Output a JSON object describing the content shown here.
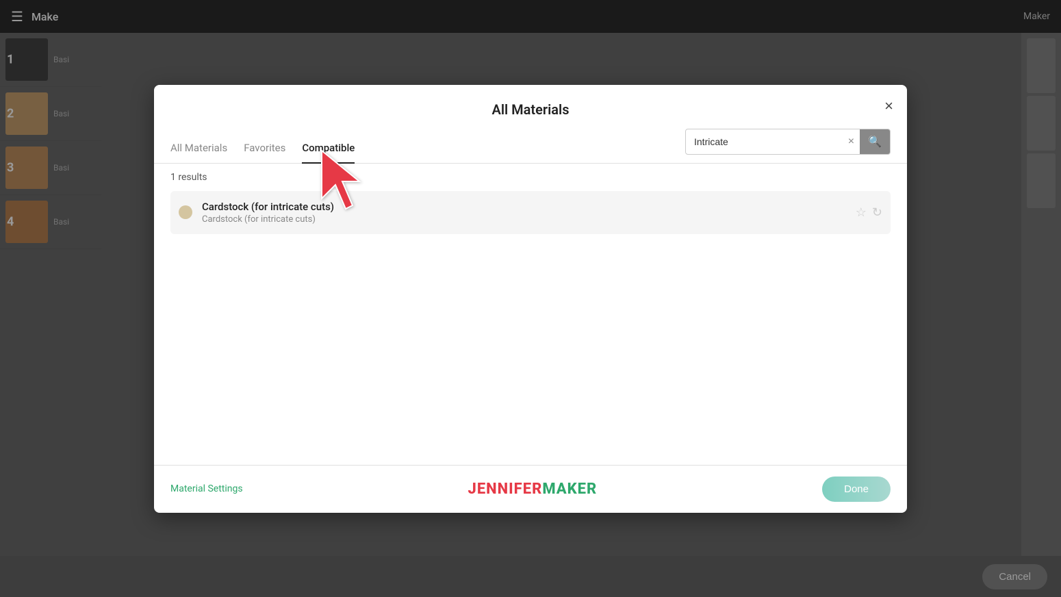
{
  "app": {
    "title": "Make",
    "top_right_label": "Maker"
  },
  "modal": {
    "title": "All Materials",
    "close_label": "×",
    "tabs": [
      {
        "id": "all",
        "label": "All Materials",
        "active": false
      },
      {
        "id": "favorites",
        "label": "Favorites",
        "active": false
      },
      {
        "id": "compatible",
        "label": "Compatible",
        "active": true
      }
    ],
    "search": {
      "value": "Intricate",
      "placeholder": "Search"
    },
    "results_count": "1 results",
    "materials": [
      {
        "name": "Cardstock (for intricate cuts)",
        "subtitle": "Cardstock (for intricate cuts)",
        "color": "#d4c5a0"
      }
    ],
    "footer": {
      "settings_label": "Material Settings",
      "brand_jennifer": "JENNIFER",
      "brand_maker": "MAKER",
      "done_label": "Done"
    }
  },
  "background": {
    "items": [
      {
        "number": "1",
        "label": "Basic",
        "color": "#444"
      },
      {
        "number": "2",
        "label": "Basic",
        "color": "#c8a06e"
      },
      {
        "number": "3",
        "label": "Basic",
        "color": "#c09060"
      },
      {
        "number": "4",
        "label": "Basic",
        "color": "#b88050"
      }
    ],
    "cancel_label": "Cancel"
  },
  "icons": {
    "menu": "☰",
    "search": "🔍",
    "star_empty": "☆",
    "refresh": "↻",
    "clear": "×"
  }
}
